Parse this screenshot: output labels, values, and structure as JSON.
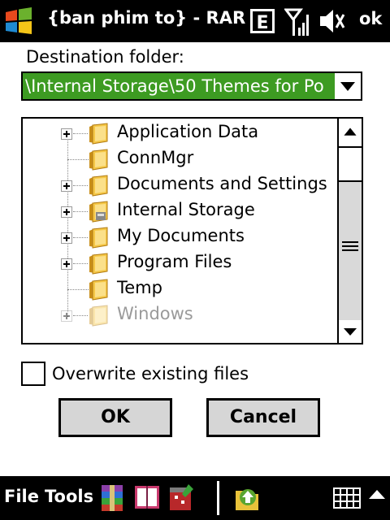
{
  "titlebar": {
    "title": "{ban phim to} - RAR",
    "ok_label": "ok",
    "icons": [
      "windows-start-icon",
      "keyboard-e-icon",
      "signal-icon",
      "volume-muted-icon"
    ]
  },
  "destination": {
    "label": "Destination folder:",
    "value": "\\Internal Storage\\50 Themes for Po"
  },
  "tree": {
    "items": [
      {
        "label": "Application Data",
        "expandable": true,
        "disabled": false,
        "icon": "folder-icon"
      },
      {
        "label": "ConnMgr",
        "expandable": false,
        "disabled": false,
        "icon": "folder-icon"
      },
      {
        "label": "Documents and Settings",
        "expandable": true,
        "disabled": false,
        "icon": "folder-icon"
      },
      {
        "label": "Internal Storage",
        "expandable": true,
        "disabled": false,
        "icon": "storage-folder-icon"
      },
      {
        "label": "My Documents",
        "expandable": true,
        "disabled": false,
        "icon": "folder-icon"
      },
      {
        "label": "Program Files",
        "expandable": true,
        "disabled": false,
        "icon": "folder-icon"
      },
      {
        "label": "Temp",
        "expandable": false,
        "disabled": false,
        "icon": "folder-icon"
      },
      {
        "label": "Windows",
        "expandable": true,
        "disabled": true,
        "icon": "folder-icon"
      }
    ]
  },
  "options": {
    "overwrite_label": "Overwrite existing files",
    "overwrite_checked": false
  },
  "buttons": {
    "ok": "OK",
    "cancel": "Cancel"
  },
  "bottombar": {
    "file": "File",
    "tools": "Tools",
    "icons": [
      "winrar-archive-icon",
      "book-icon",
      "archive-tool-icon",
      "up-folder-icon",
      "keyboard-icon",
      "up-arrow-icon"
    ]
  },
  "colors": {
    "accent_green": "#3d9b22",
    "button_gray": "#d6d6d6",
    "bar_black": "#000000"
  }
}
